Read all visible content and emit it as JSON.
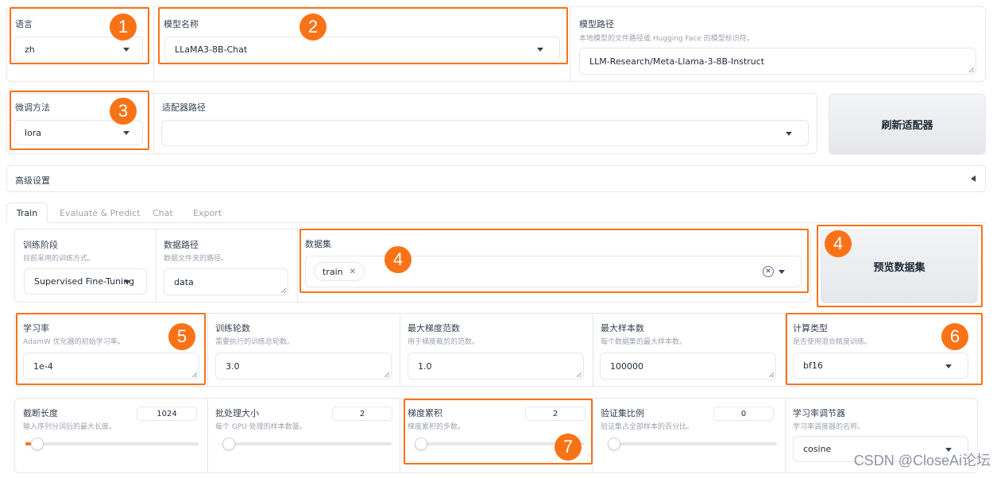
{
  "top": {
    "lang": {
      "label": "语言",
      "value": "zh"
    },
    "model_name": {
      "label": "模型名称",
      "value": "LLaMA3-8B-Chat"
    },
    "model_path": {
      "label": "模型路径",
      "desc": "本地模型的文件路径或 Hugging Face 的模型标识符。",
      "value": "LLM-Research/Meta-Llama-3-8B-Instruct"
    },
    "finetune": {
      "label": "微调方法",
      "value": "lora"
    },
    "adapter": {
      "label": "适配器路径",
      "value": ""
    },
    "refresh_label": "刷新适配器",
    "advanced_label": "高级设置",
    "advanced_icon": "triangle-left-icon"
  },
  "tabs": [
    "Train",
    "Evaluate & Predict",
    "Chat",
    "Export"
  ],
  "train": {
    "stage": {
      "label": "训练阶段",
      "desc": "目前采用的训练方式。",
      "value": "Supervised Fine-Tuning"
    },
    "dataset_dir": {
      "label": "数据路径",
      "desc": "数据文件夹的路径。",
      "value": "data"
    },
    "dataset": {
      "label": "数据集",
      "chips": [
        "train"
      ]
    },
    "preview_label": "预览数据集",
    "lr": {
      "label": "学习率",
      "desc": "AdamW 优化器的初始学习率。",
      "value": "1e-4"
    },
    "epochs": {
      "label": "训练轮数",
      "desc": "需要执行的训练总轮数。",
      "value": "3.0"
    },
    "grad_norm": {
      "label": "最大梯度范数",
      "desc": "用于梯度裁剪的范数。",
      "value": "1.0"
    },
    "max_samples": {
      "label": "最大样本数",
      "desc": "每个数据集的最大样本数。",
      "value": "100000"
    },
    "compute_type": {
      "label": "计算类型",
      "desc": "是否使用混合精度训练。",
      "value": "bf16"
    },
    "cutoff_len": {
      "label": "截断长度",
      "desc": "输入序列分词后的最大长度。",
      "value": "1024",
      "fraction": 0.03
    },
    "batch_size": {
      "label": "批处理大小",
      "desc": "每个 GPU 处理的样本数量。",
      "value": "2",
      "fraction": 0.0
    },
    "grad_accum": {
      "label": "梯度累积",
      "desc": "梯度累积的步数。",
      "value": "2",
      "fraction": 0.0
    },
    "val_size": {
      "label": "验证集比例",
      "desc": "验证集占全部样本的百分比。",
      "value": "0",
      "fraction": 0.0
    },
    "lr_scheduler": {
      "label": "学习率调节器",
      "desc": "学习率调度器的名称。",
      "value": "cosine"
    }
  },
  "annotations": [
    "1",
    "2",
    "3",
    "4",
    "4",
    "5",
    "6",
    "7"
  ],
  "accent_color": "#f97316",
  "watermark": "CSDN @CloseAi论坛"
}
